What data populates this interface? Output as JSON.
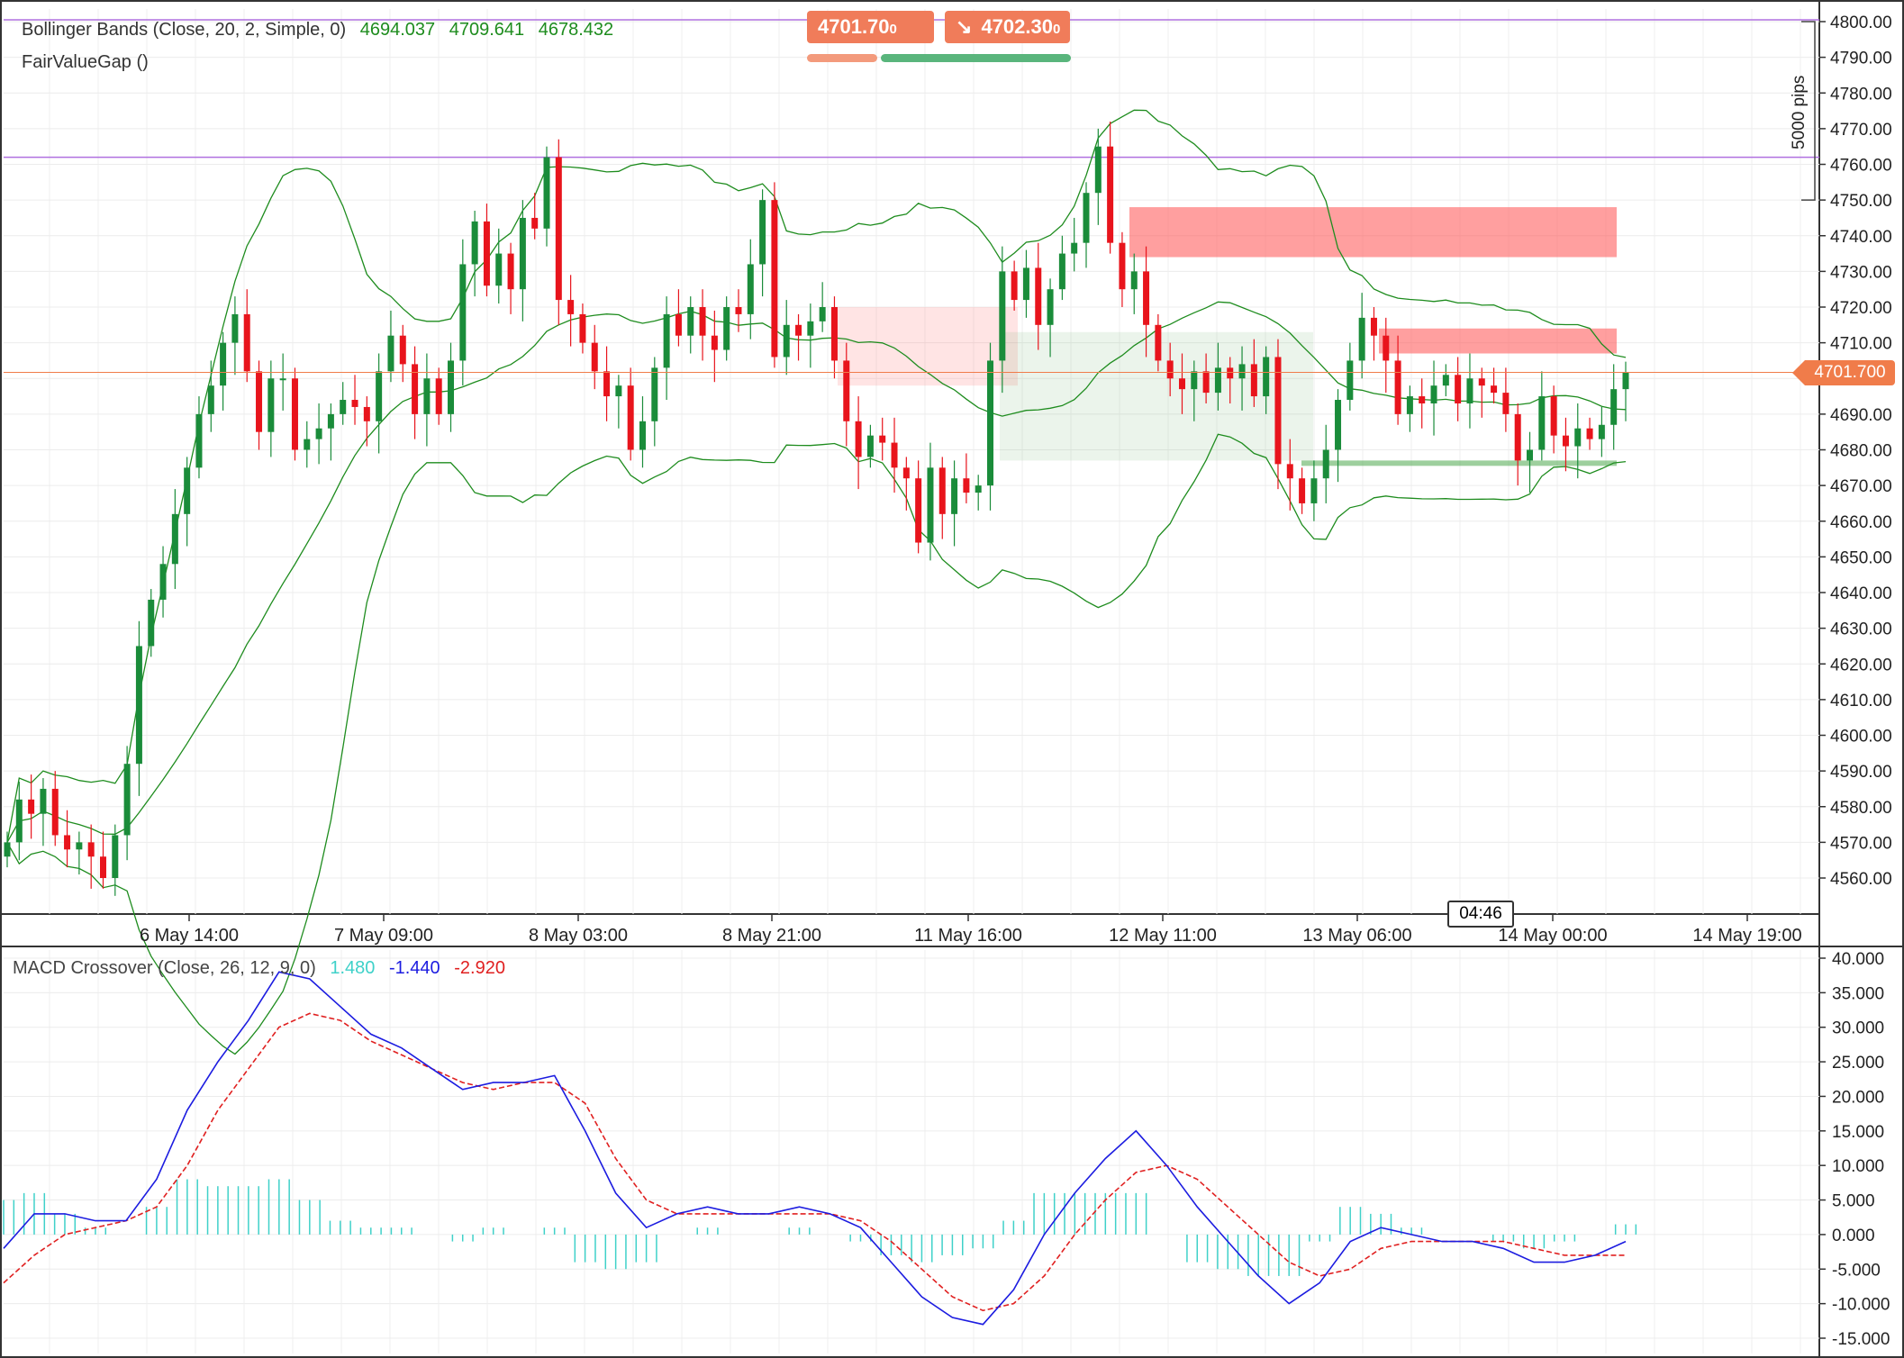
{
  "main_chart": {
    "indicators": [
      {
        "name": "Bollinger Bands (Close, 20, 2, Simple, 0)",
        "values": [
          "4694.037",
          "4709.641",
          "4678.432"
        ],
        "color": "#1e8c1e"
      },
      {
        "name": "FairValueGap ()",
        "values": []
      }
    ],
    "sell_price": "4701.70",
    "sell_sub": "0",
    "buy_price": "4702.30",
    "buy_sub": "0",
    "last_price_label": "4701.700",
    "pip_label": "5000 pips",
    "countdown": "04:46"
  },
  "macd": {
    "name": "MACD Crossover (Close, 26, 12, 9, 0)",
    "values": [
      "1.480",
      "-1.440",
      "-2.920"
    ],
    "colors": [
      "#3fd1c9",
      "#1c1ce0",
      "#e02020"
    ]
  },
  "chart_data": [
    {
      "type": "candlestick",
      "title": "",
      "ylim": [
        4550,
        4800
      ],
      "yticks": [
        "4800.00",
        "4790.00",
        "4780.00",
        "4770.00",
        "4760.00",
        "4750.00",
        "4740.00",
        "4730.00",
        "4720.00",
        "4710.00",
        "4700.00",
        "4690.00",
        "4680.00",
        "4670.00",
        "4660.00",
        "4650.00",
        "4640.00",
        "4630.00",
        "4620.00",
        "4610.00",
        "4600.00",
        "4590.00",
        "4580.00",
        "4570.00",
        "4560.00"
      ],
      "xticks": [
        "6 May 14:00",
        "7 May 09:00",
        "8 May 03:00",
        "8 May 21:00",
        "11 May 16:00",
        "12 May 11:00",
        "13 May 06:00",
        "14 May 00:00",
        "14 May 19:00"
      ],
      "colors": {
        "up": "#1a8c3a",
        "down": "#e8141c",
        "band": "#1e8c1e",
        "last": "#f07c4a"
      },
      "candles_close": [
        4570,
        4582,
        4578,
        4585,
        4572,
        4568,
        4570,
        4566,
        4560,
        4572,
        4592,
        4625,
        4638,
        4648,
        4662,
        4675,
        4690,
        4698,
        4710,
        4718,
        4702,
        4685,
        4700,
        4700,
        4680,
        4683,
        4686,
        4690,
        4694,
        4692,
        4688,
        4702,
        4712,
        4704,
        4690,
        4700,
        4690,
        4705,
        4732,
        4744,
        4726,
        4735,
        4725,
        4745,
        4742,
        4762,
        4722,
        4718,
        4710,
        4702,
        4695,
        4698,
        4680,
        4688,
        4703,
        4718,
        4712,
        4720,
        4712,
        4708,
        4720,
        4718,
        4732,
        4750,
        4706,
        4715,
        4712,
        4716,
        4720,
        4705,
        4688,
        4678,
        4684,
        4682,
        4675,
        4672,
        4654,
        4675,
        4662,
        4672,
        4668,
        4670,
        4705,
        4730,
        4722,
        4731,
        4715,
        4725,
        4735,
        4738,
        4752,
        4765,
        4738,
        4725,
        4730,
        4715,
        4705,
        4700,
        4697,
        4702,
        4696,
        4703,
        4700,
        4704,
        4695,
        4706,
        4676,
        4672,
        4665,
        4672,
        4680,
        4694,
        4705,
        4717,
        4712,
        4705,
        4690,
        4695,
        4693,
        4698,
        4701,
        4693,
        4700,
        4698,
        4696,
        4690,
        4677,
        4680,
        4695,
        4684,
        4681,
        4686,
        4683,
        4687,
        4697,
        4701.7
      ],
      "gaps": [
        {
          "from": 4734,
          "to": 4748,
          "kind": "bearish"
        },
        {
          "from": 4707,
          "to": 4714,
          "kind": "bearish"
        },
        {
          "from": 4698,
          "to": 4720,
          "kind": "bearish"
        },
        {
          "from": 4677,
          "to": 4713,
          "kind": "bullish"
        },
        {
          "from": 4675.5,
          "to": 4677,
          "kind": "bullish"
        }
      ]
    },
    {
      "type": "line",
      "title": "",
      "ylim": [
        -15,
        40
      ],
      "yticks": [
        "40.000",
        "35.000",
        "30.000",
        "25.000",
        "20.000",
        "15.000",
        "10.000",
        "5.000",
        "0.000",
        "-5.000",
        "-10.000",
        "-15.000"
      ],
      "series": [
        {
          "name": "",
          "values": [
            -2,
            3,
            3,
            2,
            2,
            8,
            18,
            25,
            31,
            38,
            37,
            33,
            29,
            27,
            24,
            21,
            22,
            22,
            23,
            15,
            6,
            1,
            3,
            4,
            3,
            3,
            4,
            3,
            1,
            -4,
            -9,
            -12,
            -13,
            -8,
            0,
            6,
            11,
            15,
            10,
            4,
            -1,
            -6,
            -10,
            -7,
            -1,
            1,
            0,
            -1,
            -1,
            -2,
            -4,
            -4,
            -3,
            -1
          ]
        },
        {
          "name": "",
          "values": [
            -7,
            -3,
            0,
            1,
            2,
            4,
            10,
            18,
            24,
            30,
            32,
            31,
            28,
            26,
            24,
            22,
            21,
            22,
            22,
            19,
            11,
            5,
            3,
            3,
            3,
            3,
            3,
            3,
            2,
            -1,
            -5,
            -9,
            -11,
            -10,
            -6,
            0,
            5,
            9,
            10,
            8,
            4,
            0,
            -4,
            -6,
            -5,
            -2,
            -1,
            -1,
            -1,
            -1,
            -2,
            -3,
            -3,
            -3
          ]
        },
        {
          "name": "",
          "values": [
            5,
            6,
            3,
            1,
            0,
            4,
            8,
            7,
            7,
            8,
            5,
            2,
            1,
            1,
            0,
            -1,
            1,
            0,
            1,
            -4,
            -5,
            -4,
            0,
            1,
            0,
            0,
            1,
            0,
            -1,
            -3,
            -4,
            -3,
            -2,
            2,
            6,
            6,
            6,
            6,
            0,
            -4,
            -5,
            -6,
            -6,
            -1,
            4,
            3,
            1,
            0,
            0,
            -1,
            -2,
            -1,
            0,
            1.48
          ]
        }
      ]
    }
  ]
}
